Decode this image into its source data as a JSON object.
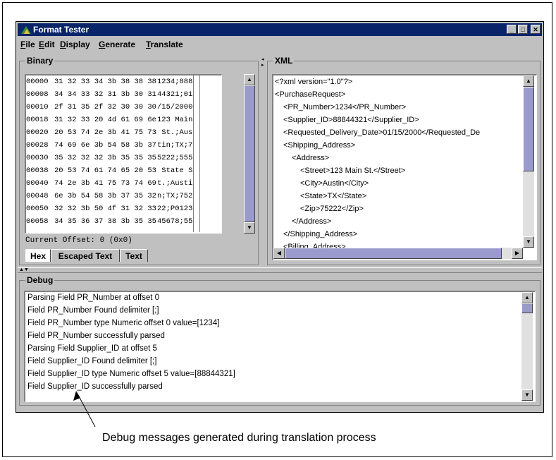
{
  "window": {
    "title": "Format Tester"
  },
  "menu": [
    "File",
    "Edit",
    "Display",
    "Generate",
    "Translate"
  ],
  "binary": {
    "title": "Binary",
    "rows": [
      {
        "offset": "00000",
        "bytes": "31 32 33 34 3b 38 38 38",
        "text": "1234;888"
      },
      {
        "offset": "00008",
        "bytes": "34 34 33 32 31 3b 30 31",
        "text": "44321;01"
      },
      {
        "offset": "00010",
        "bytes": "2f 31 35 2f 32 30 30 30",
        "text": "/15/2000"
      },
      {
        "offset": "00018",
        "bytes": "31 32 33 20 4d 61 69 6e",
        "text": "123 Main"
      },
      {
        "offset": "00020",
        "bytes": "20 53 74 2e 3b 41 75 73",
        "text": " St.;Aus"
      },
      {
        "offset": "00028",
        "bytes": "74 69 6e 3b 54 58 3b 37",
        "text": "tin;TX;7"
      },
      {
        "offset": "00030",
        "bytes": "35 32 32 32 3b 35 35 35",
        "text": "5222;555"
      },
      {
        "offset": "00038",
        "bytes": "20 53 74 61 74 65 20 53",
        "text": " State S"
      },
      {
        "offset": "00040",
        "bytes": "74 2e 3b 41 75 73 74 69",
        "text": "t.;Austi"
      },
      {
        "offset": "00048",
        "bytes": "6e 3b 54 58 3b 37 35 32",
        "text": "n;TX;752"
      },
      {
        "offset": "00050",
        "bytes": "32 32 3b 50 4f 31 32 33",
        "text": "22;P0123"
      },
      {
        "offset": "00058",
        "bytes": "34 35 36 37 38 3b 35 35",
        "text": "45678;55"
      }
    ],
    "current_offset": "Current Offset: 0 (0x0)",
    "tabs": [
      "Hex",
      "Escaped Text",
      "Text"
    ]
  },
  "xml": {
    "title": "XML",
    "lines": [
      {
        "indent": 0,
        "text": "<?xml version=\"1.0\"?>"
      },
      {
        "indent": 0,
        "text": "<PurchaseRequest>"
      },
      {
        "indent": 1,
        "text": "<PR_Number>1234</PR_Number>"
      },
      {
        "indent": 1,
        "text": "<Supplier_ID>88844321</Supplier_ID>"
      },
      {
        "indent": 1,
        "text": "<Requested_Delivery_Date>01/15/2000</Requested_De"
      },
      {
        "indent": 1,
        "text": "<Shipping_Address>"
      },
      {
        "indent": 2,
        "text": "<Address>"
      },
      {
        "indent": 3,
        "text": "<Street>123 Main St.</Street>"
      },
      {
        "indent": 3,
        "text": "<City>Austin</City>"
      },
      {
        "indent": 3,
        "text": "<State>TX</State>"
      },
      {
        "indent": 3,
        "text": "<Zip>75222</Zip>"
      },
      {
        "indent": 2,
        "text": "</Address>"
      },
      {
        "indent": 1,
        "text": "</Shipping_Address>"
      },
      {
        "indent": 1,
        "text": "<Billing_Address>"
      }
    ]
  },
  "debug": {
    "title": "Debug",
    "lines": [
      "Parsing Field PR_Number at offset 0",
      "  Field PR_Number Found delimiter [;]",
      "  Field PR_Number type Numeric offset 0 value=[1234]",
      "Field PR_Number successfully parsed",
      "Parsing Field Supplier_ID at offset 5",
      "  Field Supplier_ID Found delimiter [;]",
      "  Field Supplier_ID type Numeric offset 5 value=[88844321]",
      "Field Supplier_ID successfully parsed"
    ]
  },
  "caption": "Debug messages generated during translation process",
  "colors": {
    "titlebar": "#0a246a",
    "window": "#c0c0c0",
    "scroll_thumb": "#9a9acc"
  }
}
